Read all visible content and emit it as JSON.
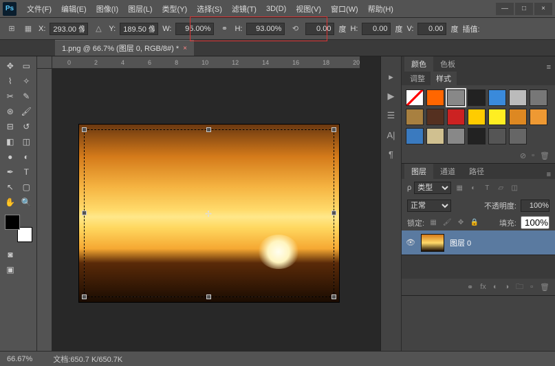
{
  "app": {
    "logo": "Ps"
  },
  "menu": {
    "file": "文件(F)",
    "edit": "编辑(E)",
    "image": "图像(I)",
    "layer": "图层(L)",
    "type": "类型(Y)",
    "select": "选择(S)",
    "filter": "滤镜(T)",
    "threeD": "3D(D)",
    "view": "视图(V)",
    "window": "窗口(W)",
    "help": "帮助(H)"
  },
  "win": {
    "min": "—",
    "max": "□",
    "close": "×"
  },
  "options": {
    "x_label": "X:",
    "x_val": "293.00 像",
    "y_label": "Y:",
    "y_val": "189.50 像",
    "w_label": "W:",
    "w_val": "95.00%",
    "h_label": "H:",
    "h_val": "93.00%",
    "rot_val": "0.00",
    "deg": "度",
    "hskew_label": "H:",
    "hskew_val": "0.00",
    "vskew_label": "V:",
    "vskew_val": "0.00",
    "interp_label": "插值:"
  },
  "doc": {
    "tab": "1.png @ 66.7% (图层 0, RGB/8#) *",
    "close": "×"
  },
  "ruler_top": [
    "0",
    "2",
    "4",
    "6",
    "8",
    "10",
    "12",
    "14",
    "16",
    "18",
    "20"
  ],
  "panels": {
    "color_tab": "颜色",
    "swatch_tab": "色板",
    "adjust_tab": "调整",
    "style_tab": "样式",
    "layers_tab": "图层",
    "channels_tab": "通道",
    "paths_tab": "路径",
    "type_label": "类型",
    "blend_mode": "正常",
    "opacity_label": "不透明度:",
    "opacity_val": "100%",
    "lock_label": "锁定:",
    "fill_label": "填充:",
    "fill_val": "100%",
    "layer0_name": "图层 0",
    "swatch_colors": [
      "#ffffff",
      "#ff6600",
      "#888888",
      "#222222",
      "#3a8adb",
      "#bbbbbb",
      "#777777",
      "#a88040",
      "#553020",
      "#cc2222",
      "#ffcc00",
      "#ffee22",
      "#dd8822",
      "#ee9933",
      "#3a7abf",
      "#d0c090",
      "#888888",
      "#222222",
      "#555555",
      "#666666"
    ]
  },
  "status": {
    "zoom": "66.67%",
    "doc_label": "文档:",
    "doc_size": "650.7 K/650.7K"
  }
}
